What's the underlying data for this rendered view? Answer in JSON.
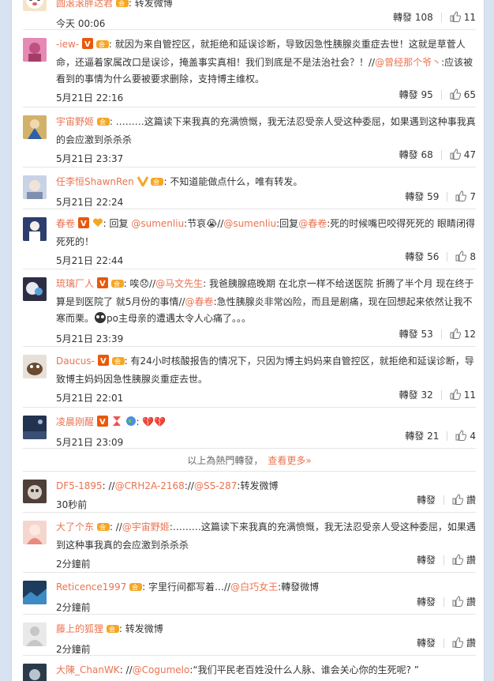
{
  "comments": [
    {
      "user": "圆滚滚胖达君",
      "text": "转发微博",
      "time": "今天 00:06",
      "repost_label": "轉發",
      "reposts": "108",
      "likes": "11"
    },
    {
      "user": "-iew-",
      "text": "就因为来自管控区，就拒绝和延误诊断，导致因急性胰腺炎重症去世！这就是草菅人命，还逼着家属改口是误诊，掩盖事实真相！我们到底是不是法治社会？！//",
      "mention": "@曾经那个爷丶",
      "text2": ":应该被看到的事情为什么要被要求删除，支持博主维权。",
      "time": "5月21日 22:16",
      "repost_label": "轉發",
      "reposts": "95",
      "likes": "65"
    },
    {
      "user": "宇宙野姬",
      "text": "………这篇读下来我真的充满愤慨，我无法忍受亲人受这种委屈，如果遇到这种事我真的会应激到杀杀杀",
      "time": "5月21日 23:37",
      "repost_label": "轉發",
      "reposts": "68",
      "likes": "47"
    },
    {
      "user": "任李恒ShawnRen",
      "text": "不知道能做点什么，唯有转发。",
      "time": "5月21日 22:24",
      "repost_label": "轉發",
      "reposts": "59",
      "likes": "7"
    },
    {
      "user": "春卷",
      "text": "回复 ",
      "mention": "@sumenliu",
      "text2": ":节哀😭//",
      "mention2": "@sumenliu",
      "text3": ":回复",
      "mention3": "@春卷",
      "text4": ":死的时候嘴巴咬得死死的 眼睛闭得死死的！",
      "time": "5月21日 22:44",
      "repost_label": "轉發",
      "reposts": "56",
      "likes": "8"
    },
    {
      "user": "琉璃厂人",
      "text": "唉😞//",
      "mention": "@马文先生",
      "text2": ": 我爸胰腺癌晚期 在北京一样不给送医院 折腾了半个月 现在终于算是到医院了 就5月份的事情//",
      "mention2": "@春卷",
      "text3": ":急性胰腺炎非常凶险，而且是剧痛，现在回想起来依然让我不寒而栗。",
      "text4": "po主母亲的遭遇太令人心痛了。。。",
      "time": "5月21日 23:39",
      "repost_label": "轉發",
      "reposts": "53",
      "likes": "12"
    },
    {
      "user": "Daucus-",
      "text": "有24小时核酸报告的情况下，只因为博主妈妈来自管控区，就拒绝和延误诊断，导致博主妈妈因急性胰腺炎重症去世。",
      "time": "5月21日 22:01",
      "repost_label": "轉發",
      "reposts": "32",
      "likes": "11"
    },
    {
      "user": "凌晨刚醒",
      "text": "💔💔",
      "time": "5月21日 23:09",
      "repost_label": "轉發",
      "reposts": "21",
      "likes": "4"
    }
  ],
  "divider": {
    "text": "以上為熱門轉發，",
    "more": "查看更多»"
  },
  "recent": [
    {
      "user": "DF5-1895",
      "text": "//",
      "mention": "@CRH2A-2168",
      "text2": "://",
      "mention2": "@SS-287",
      "text3": ":转发微博",
      "time": "30秒前",
      "repost_label": "轉發",
      "like_label": "讚"
    },
    {
      "user": "大了个东",
      "text": "//",
      "mention": "@宇宙野姬",
      "text2": ":………这篇读下来我真的充满愤慨，我无法忍受亲人受这种委屈，如果遇到这种事我真的会应激到杀杀杀",
      "time": "2分鐘前",
      "repost_label": "轉發",
      "like_label": "讚"
    },
    {
      "user": "Reticence1997",
      "text": "字里行间都写着…//",
      "mention": "@白巧女王",
      "text2": ":轉發微博",
      "time": "2分鐘前",
      "repost_label": "轉發",
      "like_label": "讚"
    },
    {
      "user": "藤上的狐狸",
      "text": "转发微博",
      "time": "2分鐘前",
      "repost_label": "轉發",
      "like_label": "讚"
    },
    {
      "user": "大陳_ChanWK",
      "text": "//",
      "mention": "@Cogumelo",
      "text2": ":“我们平民老百姓没什么人脉、谁会关心你的生死呢? ”",
      "time": "",
      "repost_label": "",
      "like_label": ""
    }
  ],
  "colors": {
    "accent": "#eb7350",
    "bg": "#d7e3f0"
  }
}
